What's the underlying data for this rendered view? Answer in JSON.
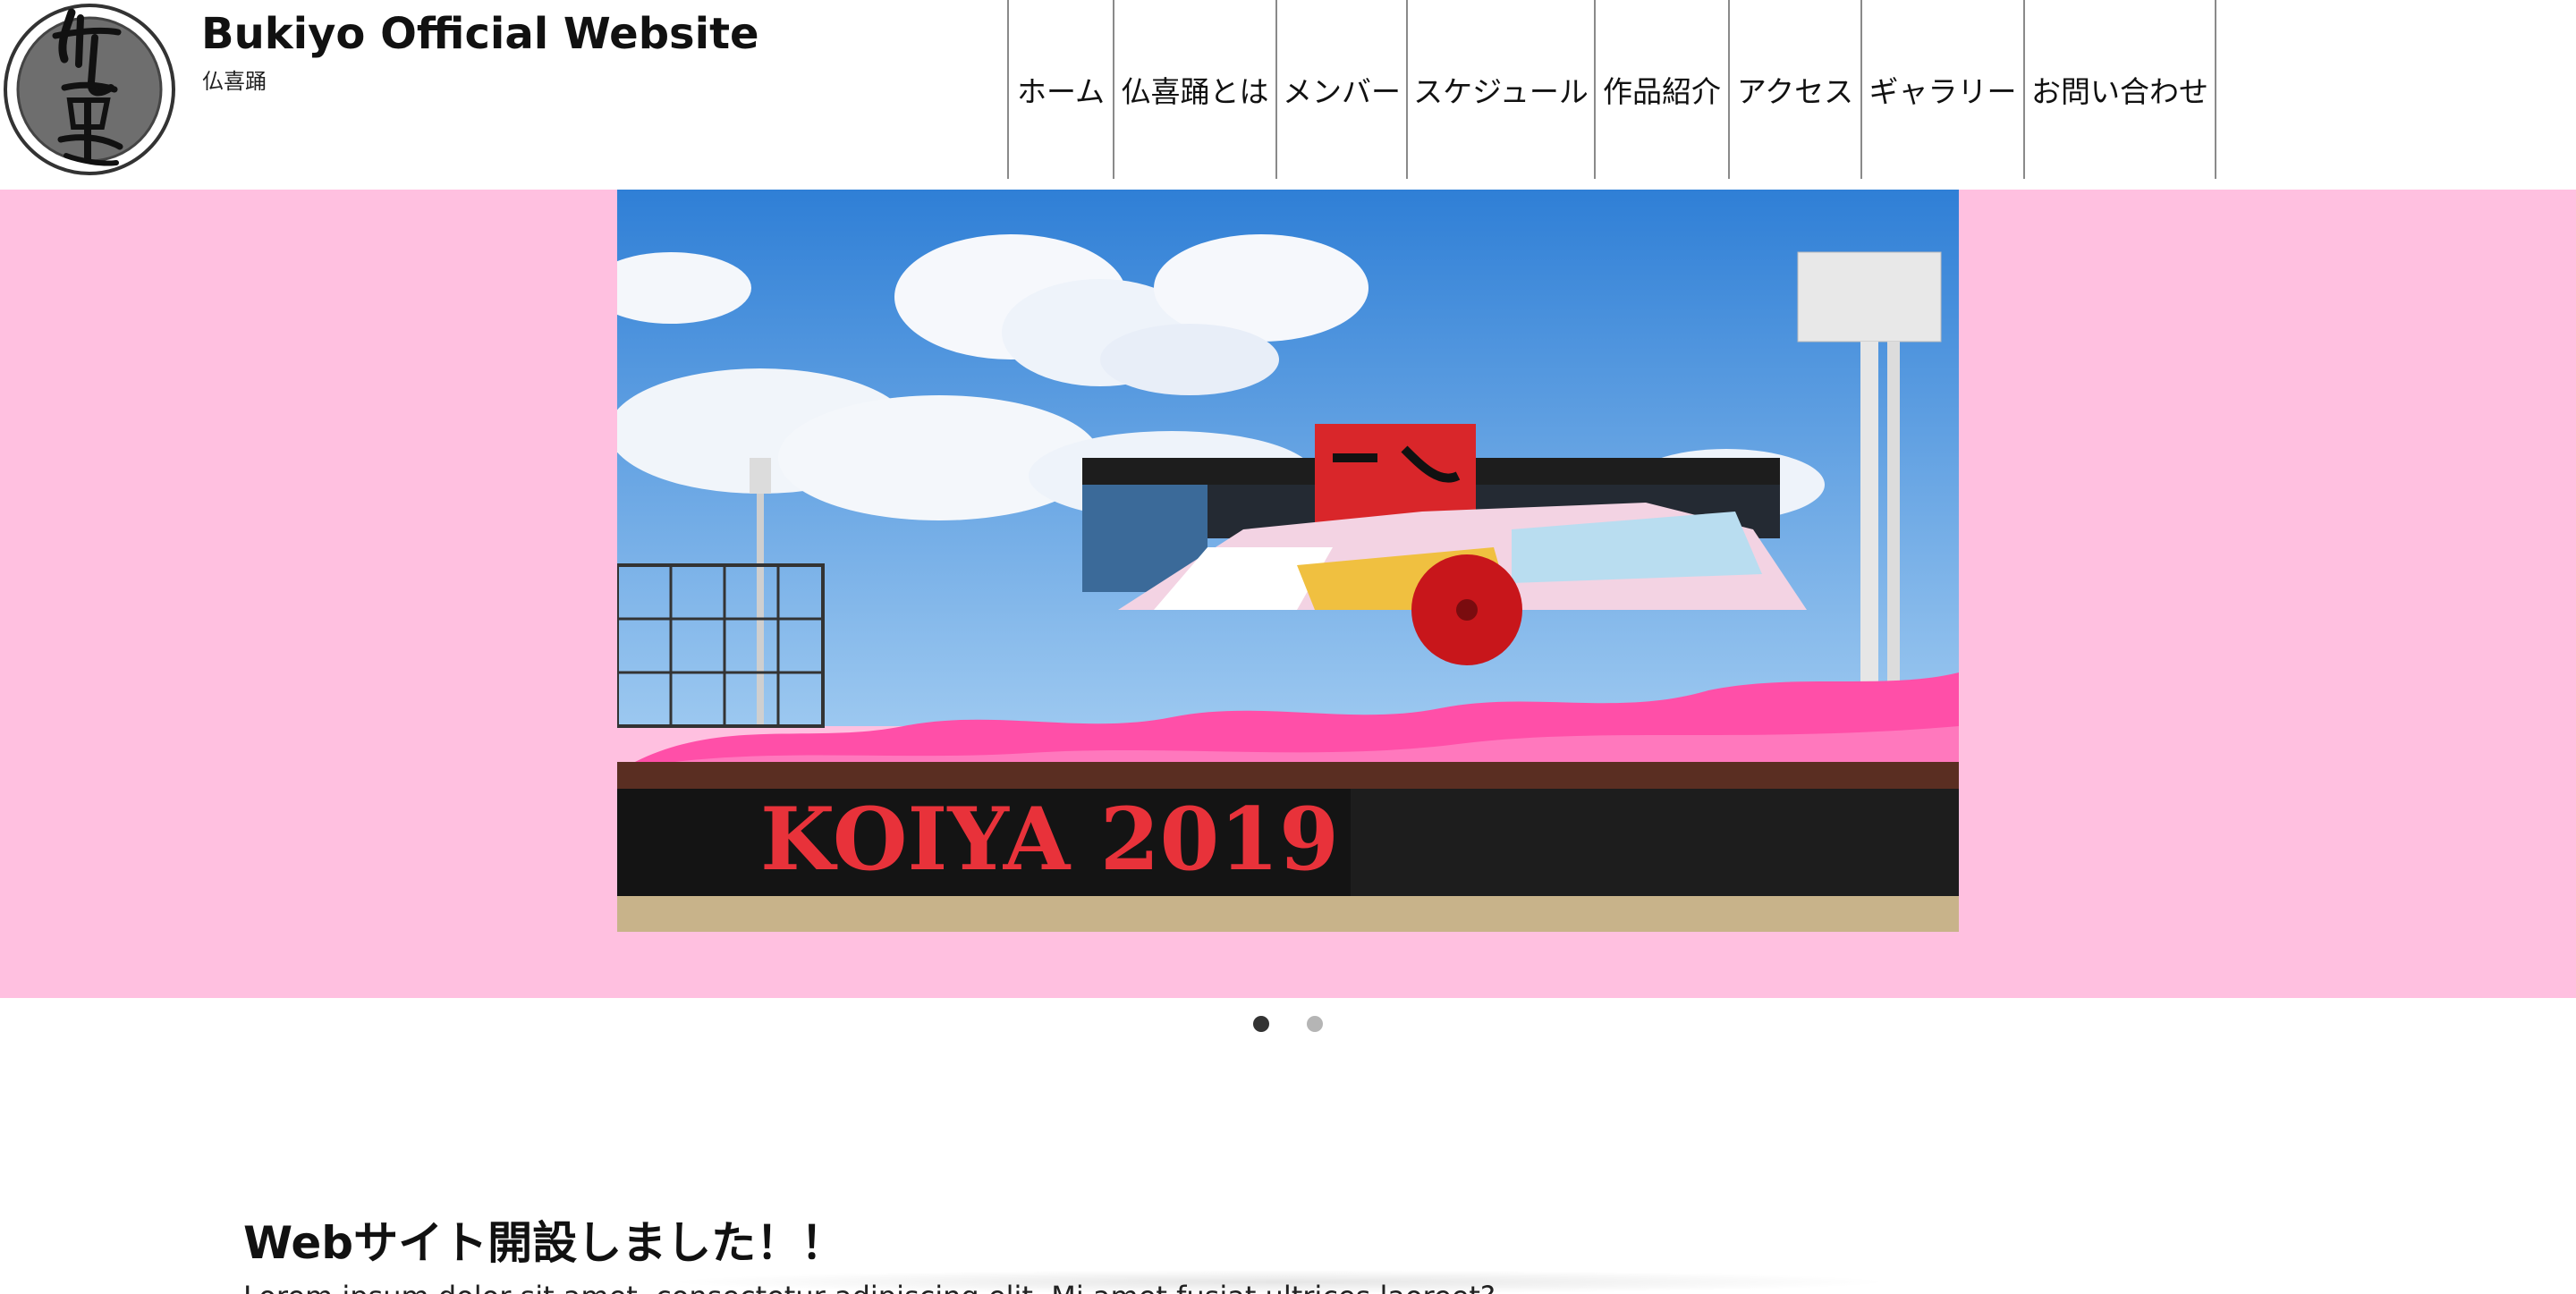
{
  "header": {
    "title": "Bukiyo Official Website",
    "subtitle": "仏喜踊",
    "logo_text": "仏喜踊"
  },
  "nav": {
    "items": [
      {
        "label": "ホーム"
      },
      {
        "label": "仏喜踊とは"
      },
      {
        "label": "メンバー"
      },
      {
        "label": "スケジュール"
      },
      {
        "label": "作品紹介"
      },
      {
        "label": "アクセス"
      },
      {
        "label": "ギャラリー"
      },
      {
        "label": "お問い合わせ"
      }
    ]
  },
  "slider": {
    "background_color": "#ffc0e0",
    "photo_banner_text": "KOIYA 2019",
    "slide_count": 2,
    "active_slide": 1
  },
  "article": {
    "title": "Webサイト開設しました！！",
    "body": "Lorem ipsum dolor sit amet, consectetur adipiscing elit. Mi amet fusiat ultrices laoreet?"
  },
  "icons": {
    "logo": "bukiyo-logo-icon",
    "dot_active": "slide-dot-active-icon",
    "dot_inactive": "slide-dot-icon"
  },
  "colors": {
    "hero_bg": "#ffc0e0",
    "nav_divider": "#8a8a8a",
    "dot_active": "#333333",
    "dot_inactive": "#b5b5b5"
  }
}
